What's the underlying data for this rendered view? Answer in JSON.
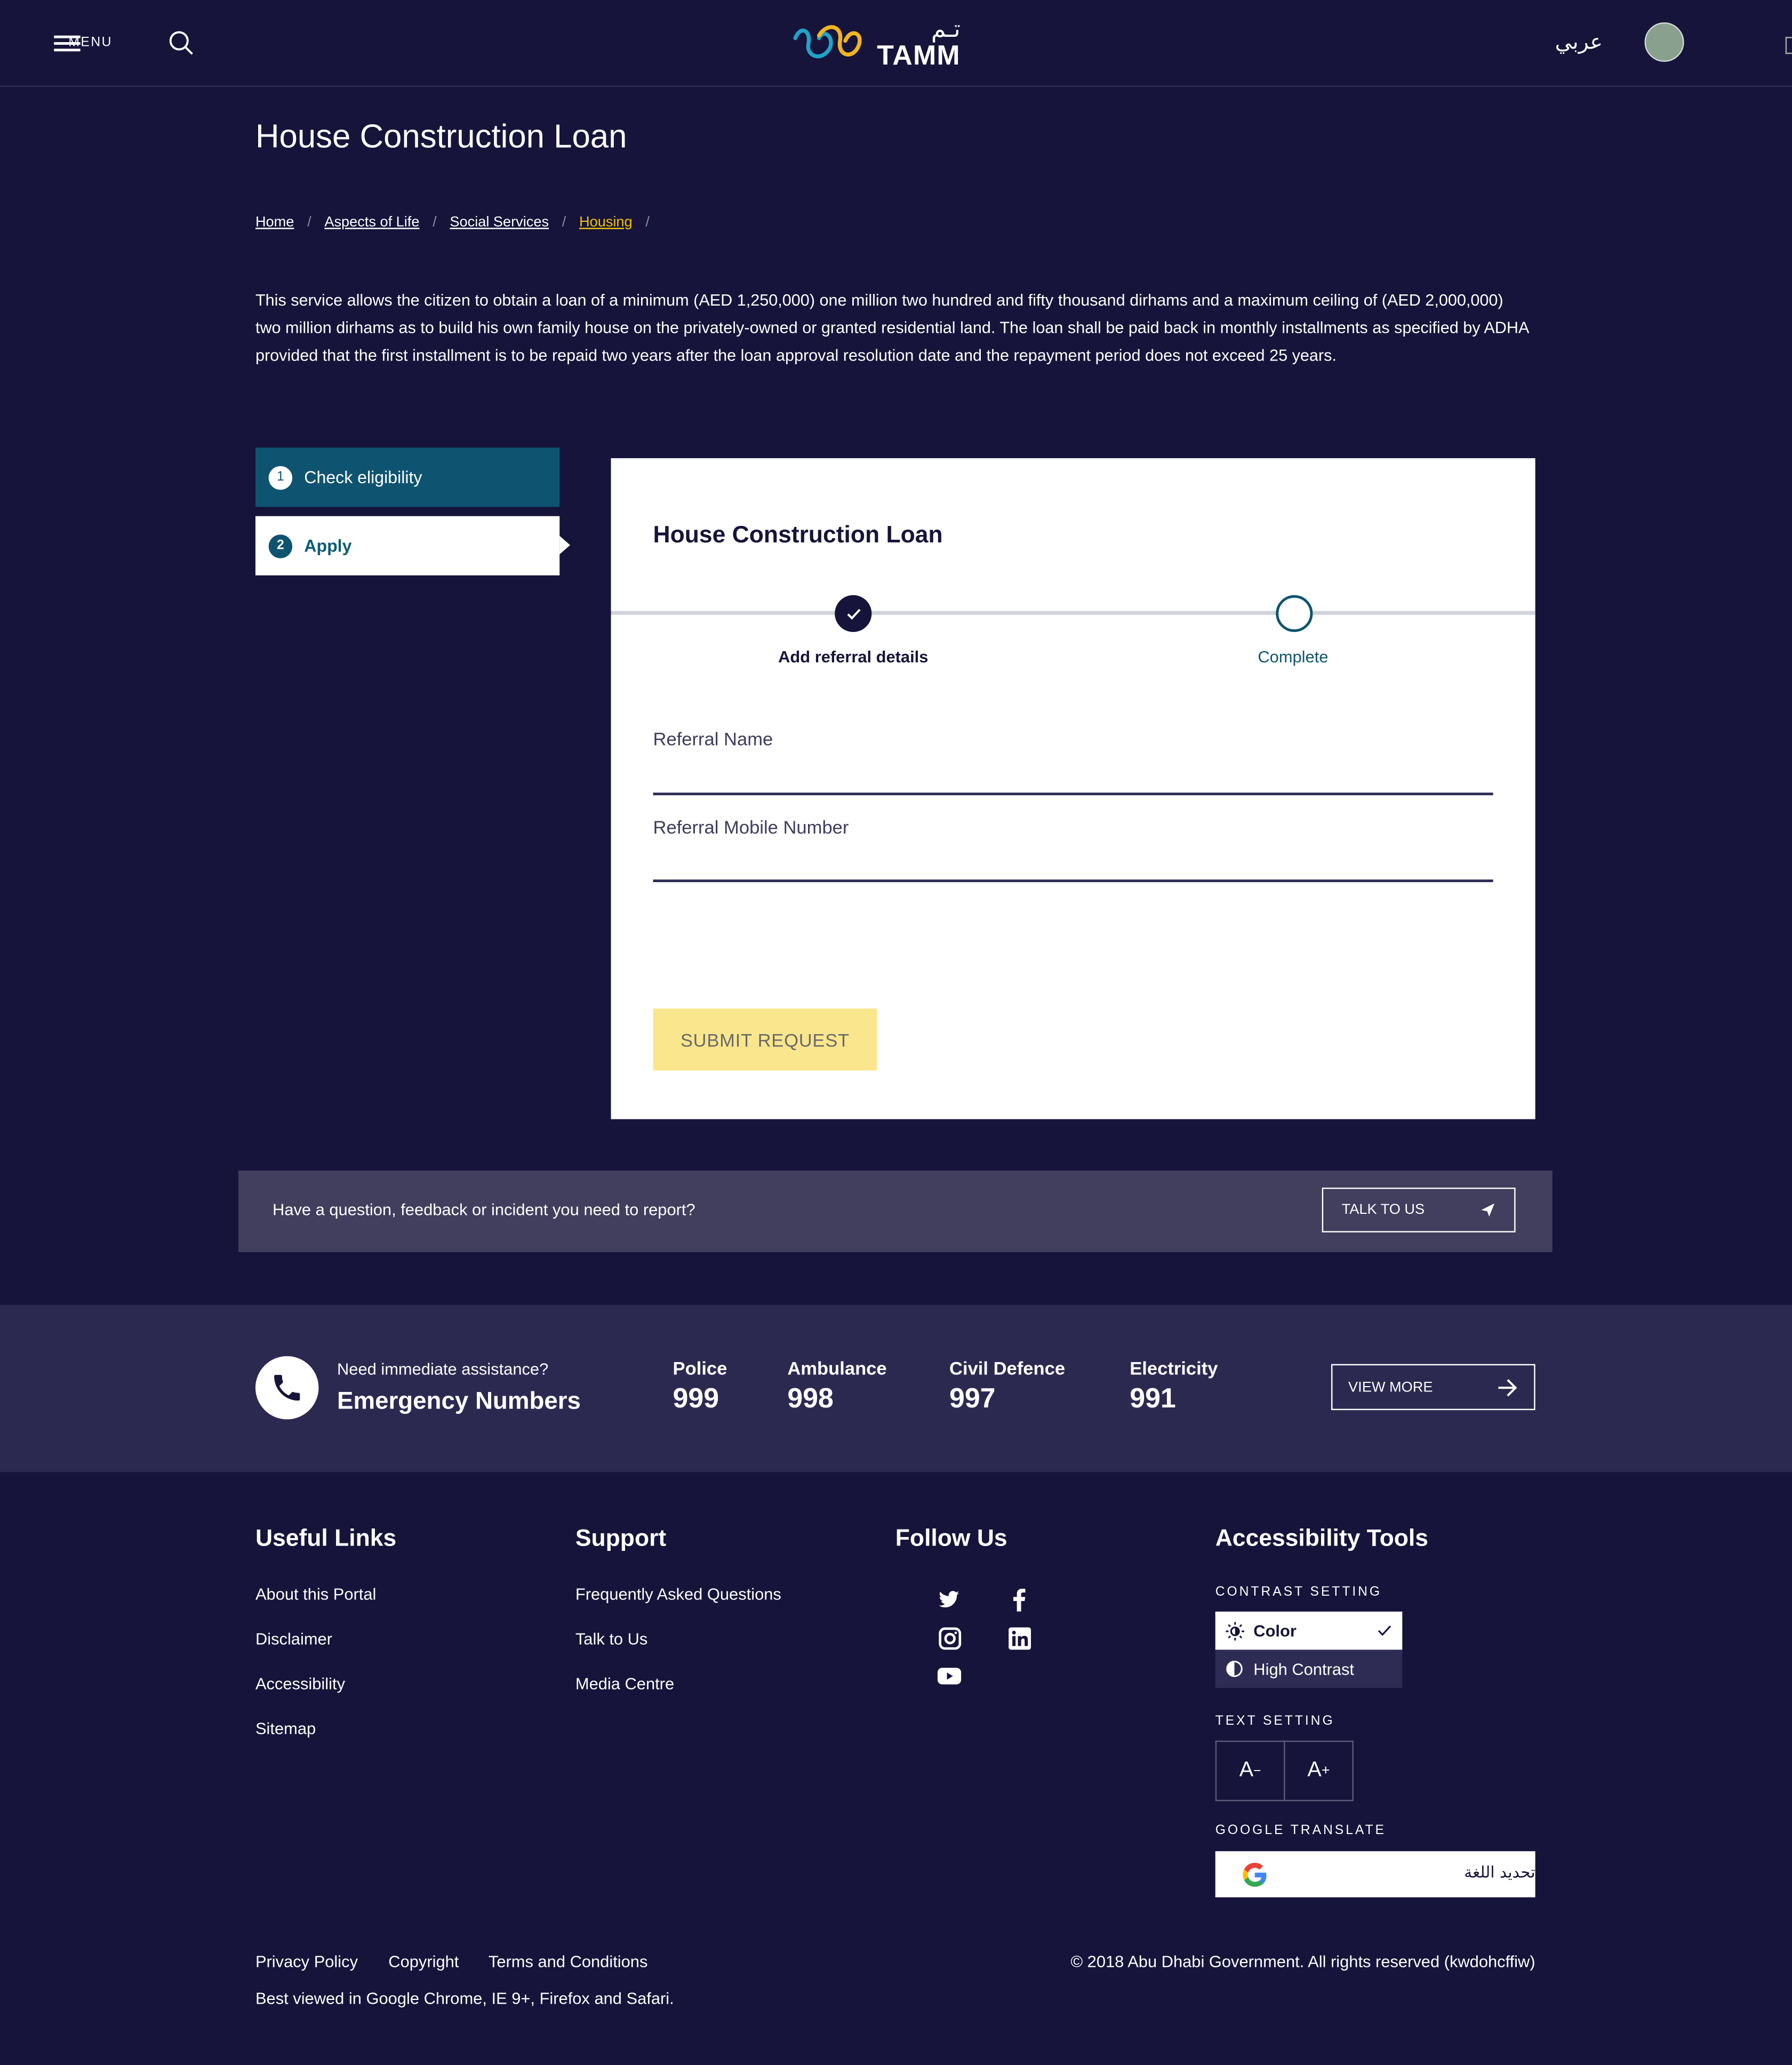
{
  "header": {
    "menu_label": "MENU",
    "logo_text": "TAMM",
    "logo_arabic": "تـم",
    "lang_toggle": "عربي"
  },
  "page": {
    "title": "House Construction Loan",
    "breadcrumb": [
      "Home",
      "Aspects of Life",
      "Social Services",
      "Housing"
    ],
    "description": "This service allows the citizen to obtain a loan of a minimum (AED 1,250,000) one million two hundred and fifty thousand dirhams and a maximum ceiling of (AED 2,000,000) two million dirhams as to build his own family house on the privately-owned or granted residential land. The loan shall be paid back in monthly installments as specified by ADHA provided that the first installment is to be repaid two years after the loan approval resolution date and the repayment period does not exceed 25 years."
  },
  "steps": [
    {
      "num": "1",
      "label": "Check eligibility"
    },
    {
      "num": "2",
      "label": "Apply"
    }
  ],
  "form": {
    "title": "House Construction Loan",
    "progress": [
      {
        "label": "Add referral details",
        "done": true
      },
      {
        "label": "Complete",
        "done": false
      }
    ],
    "fields": [
      {
        "label": "Referral Name",
        "value": ""
      },
      {
        "label": "Referral Mobile Number",
        "value": ""
      }
    ],
    "submit_label": "SUBMIT REQUEST"
  },
  "feedback": {
    "text": "Have a question, feedback or incident you need to report?",
    "button": "TALK TO US"
  },
  "emergency": {
    "prompt": "Need immediate assistance?",
    "title": "Emergency Numbers",
    "services": [
      {
        "name": "Police",
        "number": "999"
      },
      {
        "name": "Ambulance",
        "number": "998"
      },
      {
        "name": "Civil Defence",
        "number": "997"
      },
      {
        "name": "Electricity",
        "number": "991"
      }
    ],
    "view_more": "VIEW MORE"
  },
  "footer": {
    "useful_links": {
      "title": "Useful Links",
      "items": [
        "About this Portal",
        "Disclaimer",
        "Accessibility",
        "Sitemap"
      ]
    },
    "support": {
      "title": "Support",
      "items": [
        "Frequently Asked Questions",
        "Talk to Us",
        "Media Centre"
      ]
    },
    "follow": {
      "title": "Follow Us",
      "icons": [
        "twitter-icon",
        "facebook-icon",
        "instagram-icon",
        "linkedin-icon",
        "youtube-icon"
      ]
    },
    "accessibility": {
      "title": "Accessibility Tools",
      "contrast_caption": "CONTRAST SETTING",
      "contrast_options": [
        "Color",
        "High Contrast"
      ],
      "text_caption": "TEXT SETTING",
      "text_decrease": "A",
      "text_increase": "A",
      "translate_caption": "GOOGLE TRANSLATE",
      "translate_label": "تحديد اللغة"
    },
    "legal_links": [
      "Privacy Policy",
      "Copyright",
      "Terms and Conditions"
    ],
    "browser_note": "Best viewed in Google Chrome, IE 9+, Firefox and Safari.",
    "copyright": "© 2018 Abu Dhabi Government. All rights reserved (kwdohcffiw)"
  },
  "colors": {
    "background": "#16143a",
    "accent_yellow": "#f3c300",
    "step_active": "#0e5470",
    "submit_bg": "#fae68c"
  }
}
